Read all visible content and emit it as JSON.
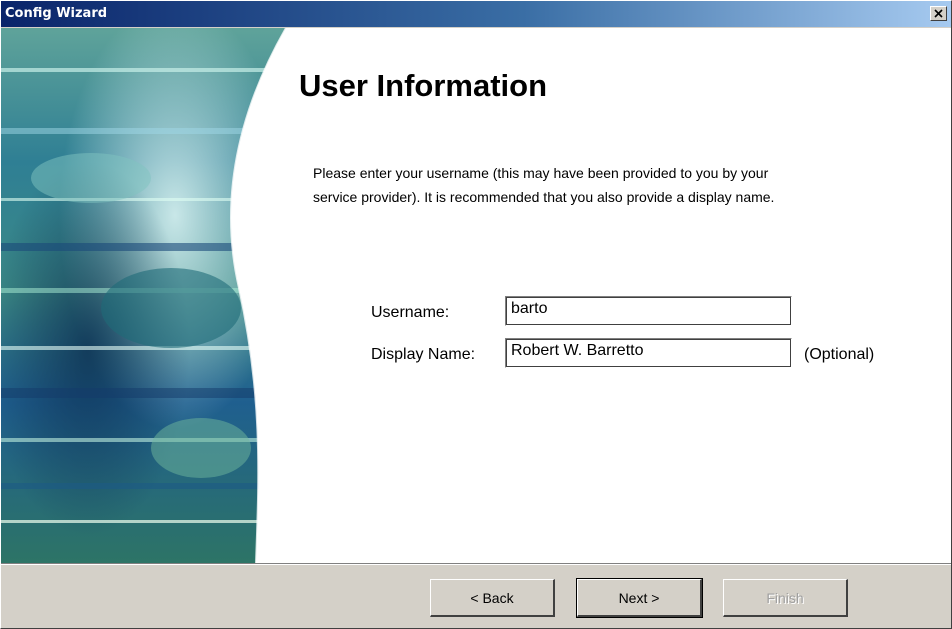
{
  "window": {
    "title": "Config Wizard"
  },
  "page": {
    "heading": "User Information",
    "intro_line1": "Please enter your username (this may have been provided to you by your",
    "intro_line2": "service provider). It is recommended that you also provide a display name."
  },
  "form": {
    "username_label": "Username:",
    "username_value": "barto",
    "display_name_label": "Display Name:",
    "display_name_value": "Robert W. Barretto",
    "display_name_hint": "(Optional)"
  },
  "buttons": {
    "back": "< Back",
    "next": "Next >",
    "finish": "Finish"
  },
  "colors": {
    "titlebar_start": "#0a246a",
    "titlebar_end": "#a6caf0",
    "dialog_face": "#d4d0c8"
  }
}
